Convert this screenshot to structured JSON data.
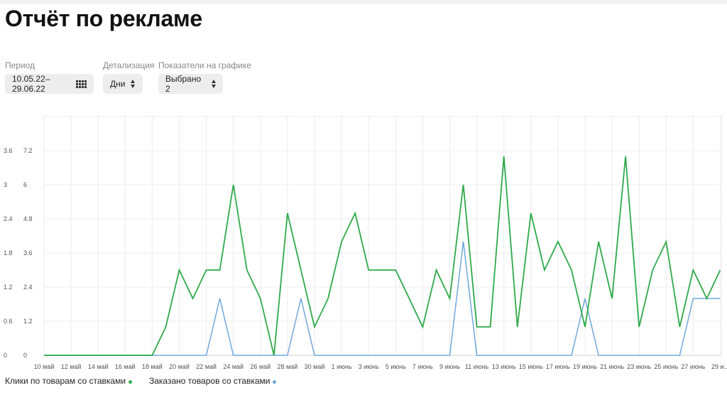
{
  "page": {
    "title": "Отчёт по рекламе"
  },
  "controls": {
    "period": {
      "label": "Период",
      "value": "10.05.22–29.06.22",
      "icon": "calendar-icon"
    },
    "detail": {
      "label": "Детализация",
      "value": "Дни",
      "icon": "sort-icon"
    },
    "metrics": {
      "label": "Показатели на графике",
      "value": "Выбрано 2",
      "icon": "sort-icon"
    }
  },
  "chart_data": {
    "type": "line",
    "x": [
      "10 май",
      "11 май",
      "12 май",
      "13 май",
      "14 май",
      "15 май",
      "16 май",
      "17 май",
      "18 май",
      "19 май",
      "20 май",
      "21 май",
      "22 май",
      "23 май",
      "24 май",
      "25 май",
      "26 май",
      "27 май",
      "28 май",
      "29 май",
      "30 май",
      "31 май",
      "1 июнь",
      "2 июнь",
      "3 июнь",
      "4 июнь",
      "5 июнь",
      "6 июнь",
      "7 июнь",
      "8 июнь",
      "9 июнь",
      "10 июнь",
      "11 июнь",
      "12 июнь",
      "13 июнь",
      "14 июнь",
      "15 июнь",
      "16 июнь",
      "17 июнь",
      "18 июнь",
      "19 июнь",
      "20 июнь",
      "21 июнь",
      "22 июнь",
      "23 июнь",
      "24 июнь",
      "25 июнь",
      "26 июнь",
      "27 июнь",
      "28 июнь",
      "29 июнь"
    ],
    "x_tick_labels": [
      "10 май",
      "12 май",
      "14 май",
      "16 май",
      "18 май",
      "20 май",
      "22 май",
      "24 май",
      "26 май",
      "28 май",
      "30 май",
      "1 июнь",
      "3 июнь",
      "5 июнь",
      "7 июнь",
      "9 июнь",
      "11 июнь",
      "13 июнь",
      "15 июнь",
      "17 июнь",
      "19 июнь",
      "21 июнь",
      "23 июнь",
      "25 июнь",
      "27 июнь",
      "29 и..."
    ],
    "left_axis_ticks": [
      "0",
      "0.6",
      "1.2",
      "1.8",
      "2.4",
      "3",
      "3.6"
    ],
    "right_axis_ticks": [
      "0",
      "1.2",
      "2.4",
      "3.6",
      "4.8",
      "6",
      "7.2"
    ],
    "ylim_left": [
      0,
      3.6
    ],
    "ylim_right": [
      0,
      7.2
    ],
    "grid": true,
    "legend_position": "bottom-left",
    "series": [
      {
        "name": "Клики по товарам со ставками",
        "axis": "right",
        "color": "#2eaa4a",
        "values": [
          0,
          0,
          0,
          0,
          0,
          0,
          0,
          0,
          0,
          1,
          3,
          2,
          3,
          3,
          6,
          3,
          2,
          0,
          5,
          3,
          1,
          2,
          4,
          5,
          3,
          3,
          3,
          2,
          1,
          3,
          2,
          6,
          1,
          1,
          7,
          1,
          5,
          3,
          4,
          3,
          1,
          4,
          2,
          7,
          1,
          3,
          4,
          1,
          3,
          2,
          3
        ]
      },
      {
        "name": "Заказано товаров со ставками",
        "axis": "left",
        "color": "#6fa8dc",
        "values": [
          0,
          0,
          0,
          0,
          0,
          0,
          0,
          0,
          0,
          0,
          0,
          0,
          0,
          1,
          0,
          0,
          0,
          0,
          0,
          1,
          0,
          0,
          0,
          0,
          0,
          0,
          0,
          0,
          0,
          0,
          0,
          2,
          0,
          0,
          0,
          0,
          0,
          0,
          0,
          0,
          1,
          0,
          0,
          0,
          0,
          0,
          0,
          0,
          1,
          1,
          1
        ]
      }
    ]
  }
}
